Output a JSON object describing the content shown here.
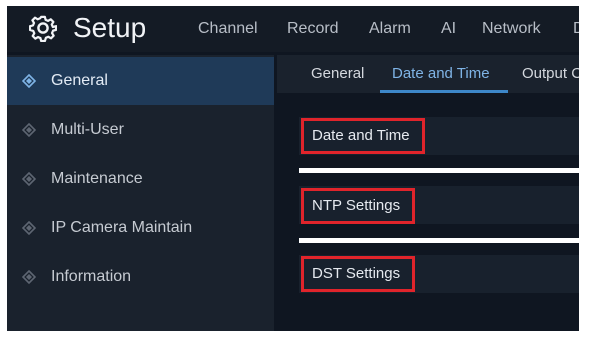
{
  "header": {
    "title": "Setup",
    "menu": [
      "Channel",
      "Record",
      "Alarm",
      "AI",
      "Network",
      "D"
    ]
  },
  "sidebar": {
    "items": [
      {
        "label": "General",
        "active": true
      },
      {
        "label": "Multi-User",
        "active": false
      },
      {
        "label": "Maintenance",
        "active": false
      },
      {
        "label": "IP Camera Maintain",
        "active": false
      },
      {
        "label": "Information",
        "active": false
      }
    ]
  },
  "tabs": [
    {
      "label": "General",
      "active": false
    },
    {
      "label": "Date and Time",
      "active": true
    },
    {
      "label": "Output C",
      "active": false
    }
  ],
  "sections": [
    {
      "label": "Date and Time"
    },
    {
      "label": "NTP Settings"
    },
    {
      "label": "DST Settings"
    }
  ],
  "icons": {
    "logo": "gear-icon",
    "sidebar": "diamond-icon"
  },
  "colors": {
    "highlight_box": "#e0242b",
    "active_tab": "#7fb4e6",
    "active_sidebar": "#1f3a58"
  }
}
